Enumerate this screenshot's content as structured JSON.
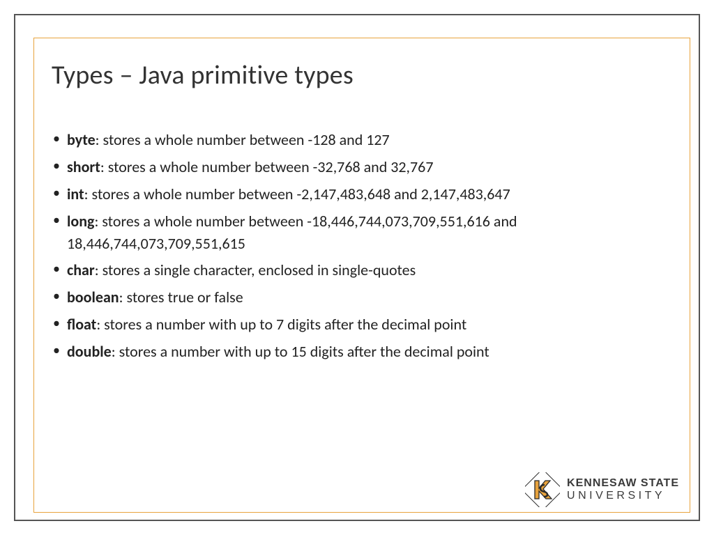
{
  "slide": {
    "title": "Types – Java primitive types",
    "items": [
      {
        "term": "byte",
        "desc": ": stores a whole number between -128 and 127"
      },
      {
        "term": "short",
        "desc": ": stores a whole number between -32,768 and 32,767"
      },
      {
        "term": "int",
        "desc": ": stores a whole number between -2,147,483,648 and 2,147,483,647"
      },
      {
        "term": "long",
        "desc": ": stores a whole number between -18,446,744,073,709,551,616 and 18,446,744,073,709,551,615"
      },
      {
        "term": "char",
        "desc": ": stores a single character, enclosed in single-quotes"
      },
      {
        "term": "boolean",
        "desc": ": stores true or false"
      },
      {
        "term": "float",
        "desc": ": stores a number with up to 7 digits after the decimal point"
      },
      {
        "term": "double",
        "desc": ": stores a number with up to 15 digits after the decimal point"
      }
    ]
  },
  "branding": {
    "line1": "KENNESAW STATE",
    "line2": "UNIVERSITY"
  }
}
